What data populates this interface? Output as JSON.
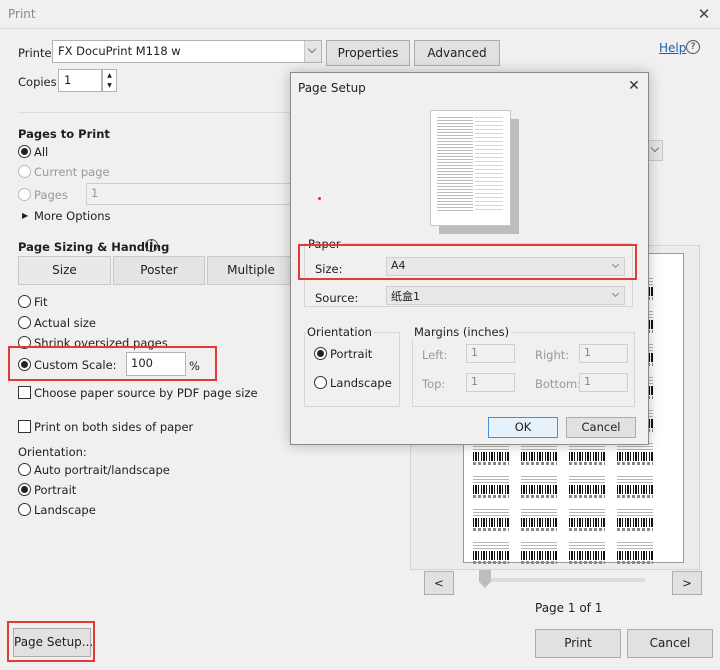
{
  "window": {
    "title": "Print"
  },
  "printer": {
    "label": "Printer:",
    "value": "FX DocuPrint M118 w",
    "properties_label": "Properties",
    "advanced_label": "Advanced",
    "help_label": "Help"
  },
  "copies": {
    "label": "Copies:",
    "value": "1"
  },
  "pages_to_print": {
    "title": "Pages to Print",
    "all": "All",
    "current_page": "Current page",
    "pages": "Pages",
    "pages_value": "1",
    "more_options": "More Options"
  },
  "page_sizing": {
    "title": "Page Sizing & Handling",
    "tabs": [
      "Size",
      "Poster",
      "Multiple"
    ],
    "fit": "Fit",
    "actual_size": "Actual size",
    "shrink": "Shrink oversized pages",
    "custom_scale": "Custom Scale:",
    "custom_scale_value": "100",
    "percent": "%",
    "choose_paper": "Choose paper source by PDF page size"
  },
  "print_both_sides": "Print on both sides of paper",
  "orientation": {
    "title": "Orientation:",
    "auto": "Auto portrait/landscape",
    "portrait": "Portrait",
    "landscape": "Landscape"
  },
  "preview": {
    "page_label": "Page 1 of 1",
    "prev": "<",
    "next": ">"
  },
  "bottom": {
    "page_setup": "Page Setup...",
    "print": "Print",
    "cancel": "Cancel"
  },
  "page_setup_dialog": {
    "title": "Page Setup",
    "paper_group": "Paper",
    "size_label": "Size:",
    "size_value": "A4",
    "source_label": "Source:",
    "source_value": "纸盒1",
    "orientation_group": "Orientation",
    "portrait": "Portrait",
    "landscape": "Landscape",
    "margins_group": "Margins (inches)",
    "left_label": "Left:",
    "left_value": "1",
    "right_label": "Right:",
    "right_value": "1",
    "top_label": "Top:",
    "top_value": "1",
    "bottom_label": "Bottom:",
    "bottom_value": "1",
    "ok": "OK",
    "cancel": "Cancel"
  },
  "colors": {
    "highlight_red": "#e53935",
    "link_blue": "#1a5fb4",
    "ok_border": "#4a90d9"
  }
}
